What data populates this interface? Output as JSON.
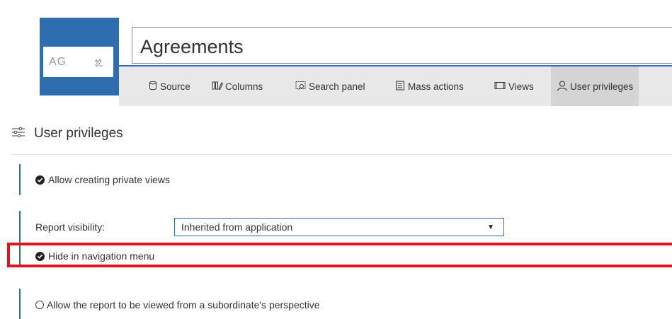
{
  "app": {
    "logo_text": "AG",
    "title": "Agreements"
  },
  "toolbar": {
    "tabs": [
      {
        "label": "Source",
        "icon": "database-icon"
      },
      {
        "label": "Columns",
        "icon": "columns-icon"
      },
      {
        "label": "Search panel",
        "icon": "search-panel-icon"
      },
      {
        "label": "Mass actions",
        "icon": "mass-actions-icon"
      },
      {
        "label": "Views",
        "icon": "views-icon"
      },
      {
        "label": "User privileges",
        "icon": "user-icon",
        "active": true
      }
    ]
  },
  "section": {
    "title": "User privileges",
    "icon": "sliders-icon"
  },
  "options": {
    "allow_private_views": {
      "label": "Allow creating private views",
      "checked": true
    },
    "report_visibility": {
      "label": "Report visibility:",
      "value": "Inherited from application"
    },
    "hide_in_nav": {
      "label": "Hide in navigation menu",
      "checked": true
    },
    "subordinate_view": {
      "label": "Allow the report to be viewed from a subordinate's perspective",
      "checked": false
    }
  },
  "colors": {
    "accent": "#2e6db0",
    "highlight": "#e0141e",
    "toolbar_bg": "#e8e8e8"
  }
}
